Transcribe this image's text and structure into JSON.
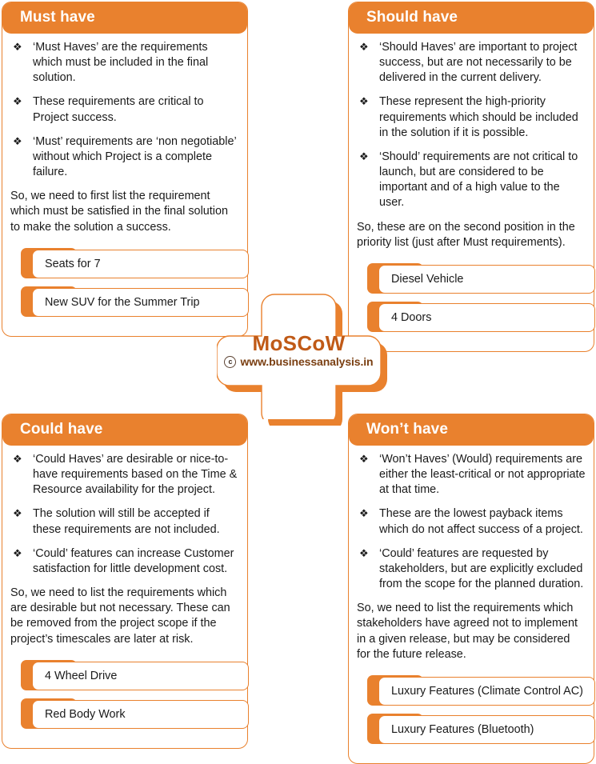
{
  "colors": {
    "orange": "#E9812E",
    "header_text": "#FFFFFF",
    "body_text": "#1A1A1A",
    "logo_word": "#C05A17",
    "logo_url": "#7A3F12"
  },
  "center": {
    "word": "MoSCoW",
    "copyright_mark": "c",
    "url": "www.businessanalysis.in"
  },
  "bullet_glyph": "❖",
  "quadrants": [
    {
      "id": "must-have",
      "title": "Must have",
      "bullets": [
        "‘Must Haves’ are the requirements which must be included in the final solution.",
        "These requirements are critical to Project success.",
        "‘Must’ requirements are ‘non negotiable’ without which Project is a complete failure."
      ],
      "summary": "So, we need to first list the requirement which must be satisfied in the final solution to make the solution a success.",
      "items": [
        "Seats for 7",
        "New SUV for the Summer Trip"
      ]
    },
    {
      "id": "should-have",
      "title": "Should have",
      "bullets": [
        "‘Should Haves’ are important to project success, but are not necessarily to be delivered in the current delivery.",
        "These represent the high-priority requirements which should be included in the solution if it is possible.",
        "‘Should’ requirements are not critical to launch, but are considered to be important and of a high value to the user."
      ],
      "summary": "So, these are on the second position in the priority list (just after Must requirements).",
      "items": [
        "Diesel Vehicle",
        "4 Doors"
      ]
    },
    {
      "id": "could-have",
      "title": "Could have",
      "bullets": [
        "‘Could Haves’ are desirable or nice-to-have requirements based on the Time & Resource availability for the project.",
        "The solution will still be accepted if these requirements are not included.",
        "‘Could’ features can increase Customer satisfaction for little development cost."
      ],
      "summary": "So, we need to list the requirements which are desirable but not necessary. These can be removed from the project scope if the project’s timescales are later at risk.",
      "items": [
        "4 Wheel Drive",
        "Red Body Work"
      ]
    },
    {
      "id": "wont-have",
      "title": "Won’t have",
      "bullets": [
        "‘Won’t Haves’ (Would) requirements are either the least-critical or not appropriate at that time.",
        "These are the lowest payback items which do not affect success of a project.",
        "‘Could’ features are requested by stakeholders, but are explicitly excluded from the scope for the planned duration."
      ],
      "summary": "So, we need to list the requirements which stakeholders have agreed not to implement in a given release, but may be considered for the future release.",
      "items": [
        "Luxury Features (Climate Control AC)",
        "Luxury Features (Bluetooth)"
      ]
    }
  ]
}
